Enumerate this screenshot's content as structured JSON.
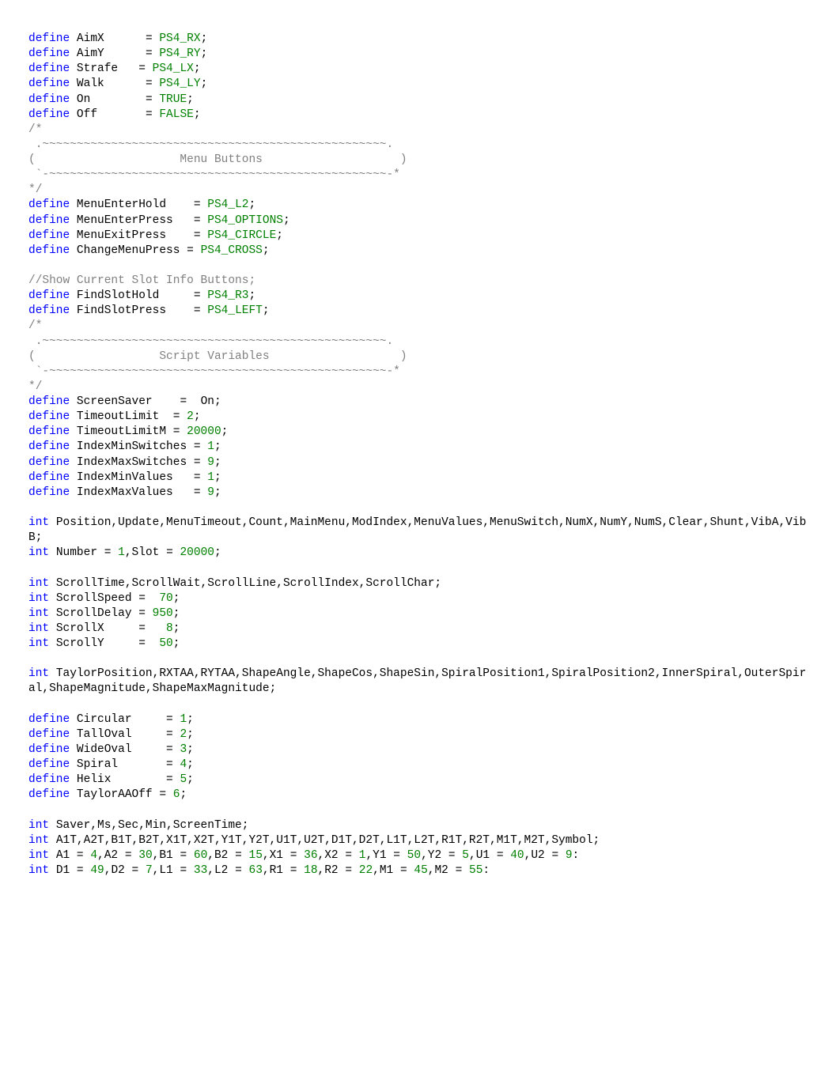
{
  "tokens": [
    {
      "t": "define ",
      "c": "kw"
    },
    {
      "t": "AimX      ",
      "c": "nm"
    },
    {
      "t": "= ",
      "c": "op"
    },
    {
      "t": "PS4_RX",
      "c": "cn"
    },
    {
      "t": ";\n",
      "c": "op"
    },
    {
      "t": "define ",
      "c": "kw"
    },
    {
      "t": "AimY      ",
      "c": "nm"
    },
    {
      "t": "= ",
      "c": "op"
    },
    {
      "t": "PS4_RY",
      "c": "cn"
    },
    {
      "t": ";\n",
      "c": "op"
    },
    {
      "t": "define ",
      "c": "kw"
    },
    {
      "t": "Strafe   ",
      "c": "nm"
    },
    {
      "t": "= ",
      "c": "op"
    },
    {
      "t": "PS4_LX",
      "c": "cn"
    },
    {
      "t": ";\n",
      "c": "op"
    },
    {
      "t": "define ",
      "c": "kw"
    },
    {
      "t": "Walk      ",
      "c": "nm"
    },
    {
      "t": "= ",
      "c": "op"
    },
    {
      "t": "PS4_LY",
      "c": "cn"
    },
    {
      "t": ";\n",
      "c": "op"
    },
    {
      "t": "define ",
      "c": "kw"
    },
    {
      "t": "On        ",
      "c": "nm"
    },
    {
      "t": "= ",
      "c": "op"
    },
    {
      "t": "TRUE",
      "c": "cn"
    },
    {
      "t": ";\n",
      "c": "op"
    },
    {
      "t": "define ",
      "c": "kw"
    },
    {
      "t": "Off       ",
      "c": "nm"
    },
    {
      "t": "= ",
      "c": "op"
    },
    {
      "t": "FALSE",
      "c": "cn"
    },
    {
      "t": ";\n",
      "c": "op"
    },
    {
      "t": "/*\n .~~~~~~~~~~~~~~~~~~~~~~~~~~~~~~~~~~~~~~~~~~~~~~~~~~.\n(                     Menu Buttons                    )\n `-~~~~~~~~~~~~~~~~~~~~~~~~~~~~~~~~~~~~~~~~~~~~~~~~~-*\n*/\n",
      "c": "cm"
    },
    {
      "t": "define ",
      "c": "kw"
    },
    {
      "t": "MenuEnterHold    ",
      "c": "nm"
    },
    {
      "t": "= ",
      "c": "op"
    },
    {
      "t": "PS4_L2",
      "c": "cn"
    },
    {
      "t": ";\n",
      "c": "op"
    },
    {
      "t": "define ",
      "c": "kw"
    },
    {
      "t": "MenuEnterPress   ",
      "c": "nm"
    },
    {
      "t": "= ",
      "c": "op"
    },
    {
      "t": "PS4_OPTIONS",
      "c": "cn"
    },
    {
      "t": ";\n",
      "c": "op"
    },
    {
      "t": "define ",
      "c": "kw"
    },
    {
      "t": "MenuExitPress    ",
      "c": "nm"
    },
    {
      "t": "= ",
      "c": "op"
    },
    {
      "t": "PS4_CIRCLE",
      "c": "cn"
    },
    {
      "t": ";\n",
      "c": "op"
    },
    {
      "t": "define ",
      "c": "kw"
    },
    {
      "t": "ChangeMenuPress ",
      "c": "nm"
    },
    {
      "t": "= ",
      "c": "op"
    },
    {
      "t": "PS4_CROSS",
      "c": "cn"
    },
    {
      "t": ";\n\n",
      "c": "op"
    },
    {
      "t": "//Show Current Slot Info Buttons;\n",
      "c": "cm"
    },
    {
      "t": "define ",
      "c": "kw"
    },
    {
      "t": "FindSlotHold     ",
      "c": "nm"
    },
    {
      "t": "= ",
      "c": "op"
    },
    {
      "t": "PS4_R3",
      "c": "cn"
    },
    {
      "t": ";\n",
      "c": "op"
    },
    {
      "t": "define ",
      "c": "kw"
    },
    {
      "t": "FindSlotPress    ",
      "c": "nm"
    },
    {
      "t": "= ",
      "c": "op"
    },
    {
      "t": "PS4_LEFT",
      "c": "cn"
    },
    {
      "t": ";\n",
      "c": "op"
    },
    {
      "t": "/*\n .~~~~~~~~~~~~~~~~~~~~~~~~~~~~~~~~~~~~~~~~~~~~~~~~~~.\n(                  Script Variables                   )\n `-~~~~~~~~~~~~~~~~~~~~~~~~~~~~~~~~~~~~~~~~~~~~~~~~~-*\n*/\n",
      "c": "cm"
    },
    {
      "t": "define ",
      "c": "kw"
    },
    {
      "t": "ScreenSaver    ",
      "c": "nm"
    },
    {
      "t": "=  ",
      "c": "op"
    },
    {
      "t": "On",
      "c": "nm"
    },
    {
      "t": ";\n",
      "c": "op"
    },
    {
      "t": "define ",
      "c": "kw"
    },
    {
      "t": "TimeoutLimit  ",
      "c": "nm"
    },
    {
      "t": "= ",
      "c": "op"
    },
    {
      "t": "2",
      "c": "cn"
    },
    {
      "t": ";\n",
      "c": "op"
    },
    {
      "t": "define ",
      "c": "kw"
    },
    {
      "t": "TimeoutLimitM ",
      "c": "nm"
    },
    {
      "t": "= ",
      "c": "op"
    },
    {
      "t": "20000",
      "c": "cn"
    },
    {
      "t": ";\n",
      "c": "op"
    },
    {
      "t": "define ",
      "c": "kw"
    },
    {
      "t": "IndexMinSwitches ",
      "c": "nm"
    },
    {
      "t": "= ",
      "c": "op"
    },
    {
      "t": "1",
      "c": "cn"
    },
    {
      "t": ";\n",
      "c": "op"
    },
    {
      "t": "define ",
      "c": "kw"
    },
    {
      "t": "IndexMaxSwitches ",
      "c": "nm"
    },
    {
      "t": "= ",
      "c": "op"
    },
    {
      "t": "9",
      "c": "cn"
    },
    {
      "t": ";\n",
      "c": "op"
    },
    {
      "t": "define ",
      "c": "kw"
    },
    {
      "t": "IndexMinValues   ",
      "c": "nm"
    },
    {
      "t": "= ",
      "c": "op"
    },
    {
      "t": "1",
      "c": "cn"
    },
    {
      "t": ";\n",
      "c": "op"
    },
    {
      "t": "define ",
      "c": "kw"
    },
    {
      "t": "IndexMaxValues   ",
      "c": "nm"
    },
    {
      "t": "= ",
      "c": "op"
    },
    {
      "t": "9",
      "c": "cn"
    },
    {
      "t": ";\n\n",
      "c": "op"
    },
    {
      "t": "int ",
      "c": "kw"
    },
    {
      "t": "Position,Update,MenuTimeout,Count,MainMenu,ModIndex,MenuValues,MenuSwitch,NumX,NumY,NumS,Clear,Shunt,VibA,VibB",
      "c": "nm"
    },
    {
      "t": ";\n",
      "c": "op"
    },
    {
      "t": "int ",
      "c": "kw"
    },
    {
      "t": "Number ",
      "c": "nm"
    },
    {
      "t": "= ",
      "c": "op"
    },
    {
      "t": "1",
      "c": "cn"
    },
    {
      "t": ",",
      "c": "op"
    },
    {
      "t": "Slot ",
      "c": "nm"
    },
    {
      "t": "= ",
      "c": "op"
    },
    {
      "t": "20000",
      "c": "cn"
    },
    {
      "t": ";\n\n",
      "c": "op"
    },
    {
      "t": "int ",
      "c": "kw"
    },
    {
      "t": "ScrollTime,ScrollWait,ScrollLine,ScrollIndex,ScrollChar",
      "c": "nm"
    },
    {
      "t": ";\n",
      "c": "op"
    },
    {
      "t": "int ",
      "c": "kw"
    },
    {
      "t": "ScrollSpeed ",
      "c": "nm"
    },
    {
      "t": "=  ",
      "c": "op"
    },
    {
      "t": "70",
      "c": "cn"
    },
    {
      "t": ";\n",
      "c": "op"
    },
    {
      "t": "int ",
      "c": "kw"
    },
    {
      "t": "ScrollDelay ",
      "c": "nm"
    },
    {
      "t": "= ",
      "c": "op"
    },
    {
      "t": "950",
      "c": "cn"
    },
    {
      "t": ";\n",
      "c": "op"
    },
    {
      "t": "int ",
      "c": "kw"
    },
    {
      "t": "ScrollX     ",
      "c": "nm"
    },
    {
      "t": "=   ",
      "c": "op"
    },
    {
      "t": "8",
      "c": "cn"
    },
    {
      "t": ";\n",
      "c": "op"
    },
    {
      "t": "int ",
      "c": "kw"
    },
    {
      "t": "ScrollY     ",
      "c": "nm"
    },
    {
      "t": "=  ",
      "c": "op"
    },
    {
      "t": "50",
      "c": "cn"
    },
    {
      "t": ";\n\n",
      "c": "op"
    },
    {
      "t": "int ",
      "c": "kw"
    },
    {
      "t": "TaylorPosition,RXTAA,RYTAA,ShapeAngle,ShapeCos,ShapeSin,SpiralPosition1,SpiralPosition2,InnerSpiral,OuterSpiral,ShapeMagnitude,ShapeMaxMagnitude",
      "c": "nm"
    },
    {
      "t": ";\n\n",
      "c": "op"
    },
    {
      "t": "define ",
      "c": "kw"
    },
    {
      "t": "Circular     ",
      "c": "nm"
    },
    {
      "t": "= ",
      "c": "op"
    },
    {
      "t": "1",
      "c": "cn"
    },
    {
      "t": ";\n",
      "c": "op"
    },
    {
      "t": "define ",
      "c": "kw"
    },
    {
      "t": "TallOval     ",
      "c": "nm"
    },
    {
      "t": "= ",
      "c": "op"
    },
    {
      "t": "2",
      "c": "cn"
    },
    {
      "t": ";\n",
      "c": "op"
    },
    {
      "t": "define ",
      "c": "kw"
    },
    {
      "t": "WideOval     ",
      "c": "nm"
    },
    {
      "t": "= ",
      "c": "op"
    },
    {
      "t": "3",
      "c": "cn"
    },
    {
      "t": ";\n",
      "c": "op"
    },
    {
      "t": "define ",
      "c": "kw"
    },
    {
      "t": "Spiral       ",
      "c": "nm"
    },
    {
      "t": "= ",
      "c": "op"
    },
    {
      "t": "4",
      "c": "cn"
    },
    {
      "t": ";\n",
      "c": "op"
    },
    {
      "t": "define ",
      "c": "kw"
    },
    {
      "t": "Helix        ",
      "c": "nm"
    },
    {
      "t": "= ",
      "c": "op"
    },
    {
      "t": "5",
      "c": "cn"
    },
    {
      "t": ";\n",
      "c": "op"
    },
    {
      "t": "define ",
      "c": "kw"
    },
    {
      "t": "TaylorAAOff ",
      "c": "nm"
    },
    {
      "t": "= ",
      "c": "op"
    },
    {
      "t": "6",
      "c": "cn"
    },
    {
      "t": ";\n\n",
      "c": "op"
    },
    {
      "t": "int ",
      "c": "kw"
    },
    {
      "t": "Saver,Ms,Sec,Min,ScreenTime",
      "c": "nm"
    },
    {
      "t": ";\n",
      "c": "op"
    },
    {
      "t": "int ",
      "c": "kw"
    },
    {
      "t": "A1T,A2T,B1T,B2T,X1T,X2T,Y1T,Y2T,U1T,U2T,D1T,D2T,L1T,L2T,R1T,R2T,M1T,M2T,Symbol",
      "c": "nm"
    },
    {
      "t": ";\n",
      "c": "op"
    },
    {
      "t": "int ",
      "c": "kw"
    },
    {
      "t": "A1 ",
      "c": "nm"
    },
    {
      "t": "= ",
      "c": "op"
    },
    {
      "t": "4",
      "c": "cn"
    },
    {
      "t": ",",
      "c": "op"
    },
    {
      "t": "A2 ",
      "c": "nm"
    },
    {
      "t": "= ",
      "c": "op"
    },
    {
      "t": "30",
      "c": "cn"
    },
    {
      "t": ",",
      "c": "op"
    },
    {
      "t": "B1 ",
      "c": "nm"
    },
    {
      "t": "= ",
      "c": "op"
    },
    {
      "t": "60",
      "c": "cn"
    },
    {
      "t": ",",
      "c": "op"
    },
    {
      "t": "B2 ",
      "c": "nm"
    },
    {
      "t": "= ",
      "c": "op"
    },
    {
      "t": "15",
      "c": "cn"
    },
    {
      "t": ",",
      "c": "op"
    },
    {
      "t": "X1 ",
      "c": "nm"
    },
    {
      "t": "= ",
      "c": "op"
    },
    {
      "t": "36",
      "c": "cn"
    },
    {
      "t": ",",
      "c": "op"
    },
    {
      "t": "X2 ",
      "c": "nm"
    },
    {
      "t": "= ",
      "c": "op"
    },
    {
      "t": "1",
      "c": "cn"
    },
    {
      "t": ",",
      "c": "op"
    },
    {
      "t": "Y1 ",
      "c": "nm"
    },
    {
      "t": "= ",
      "c": "op"
    },
    {
      "t": "50",
      "c": "cn"
    },
    {
      "t": ",",
      "c": "op"
    },
    {
      "t": "Y2 ",
      "c": "nm"
    },
    {
      "t": "= ",
      "c": "op"
    },
    {
      "t": "5",
      "c": "cn"
    },
    {
      "t": ",",
      "c": "op"
    },
    {
      "t": "U1 ",
      "c": "nm"
    },
    {
      "t": "= ",
      "c": "op"
    },
    {
      "t": "40",
      "c": "cn"
    },
    {
      "t": ",",
      "c": "op"
    },
    {
      "t": "U2 ",
      "c": "nm"
    },
    {
      "t": "= ",
      "c": "op"
    },
    {
      "t": "9",
      "c": "cn"
    },
    {
      "t": ":\n",
      "c": "op"
    },
    {
      "t": "int ",
      "c": "kw"
    },
    {
      "t": "D1 ",
      "c": "nm"
    },
    {
      "t": "= ",
      "c": "op"
    },
    {
      "t": "49",
      "c": "cn"
    },
    {
      "t": ",",
      "c": "op"
    },
    {
      "t": "D2 ",
      "c": "nm"
    },
    {
      "t": "= ",
      "c": "op"
    },
    {
      "t": "7",
      "c": "cn"
    },
    {
      "t": ",",
      "c": "op"
    },
    {
      "t": "L1 ",
      "c": "nm"
    },
    {
      "t": "= ",
      "c": "op"
    },
    {
      "t": "33",
      "c": "cn"
    },
    {
      "t": ",",
      "c": "op"
    },
    {
      "t": "L2 ",
      "c": "nm"
    },
    {
      "t": "= ",
      "c": "op"
    },
    {
      "t": "63",
      "c": "cn"
    },
    {
      "t": ",",
      "c": "op"
    },
    {
      "t": "R1 ",
      "c": "nm"
    },
    {
      "t": "= ",
      "c": "op"
    },
    {
      "t": "18",
      "c": "cn"
    },
    {
      "t": ",",
      "c": "op"
    },
    {
      "t": "R2 ",
      "c": "nm"
    },
    {
      "t": "= ",
      "c": "op"
    },
    {
      "t": "22",
      "c": "cn"
    },
    {
      "t": ",",
      "c": "op"
    },
    {
      "t": "M1 ",
      "c": "nm"
    },
    {
      "t": "= ",
      "c": "op"
    },
    {
      "t": "45",
      "c": "cn"
    },
    {
      "t": ",",
      "c": "op"
    },
    {
      "t": "M2 ",
      "c": "nm"
    },
    {
      "t": "= ",
      "c": "op"
    },
    {
      "t": "55",
      "c": "cn"
    },
    {
      "t": ":",
      "c": "op"
    }
  ]
}
